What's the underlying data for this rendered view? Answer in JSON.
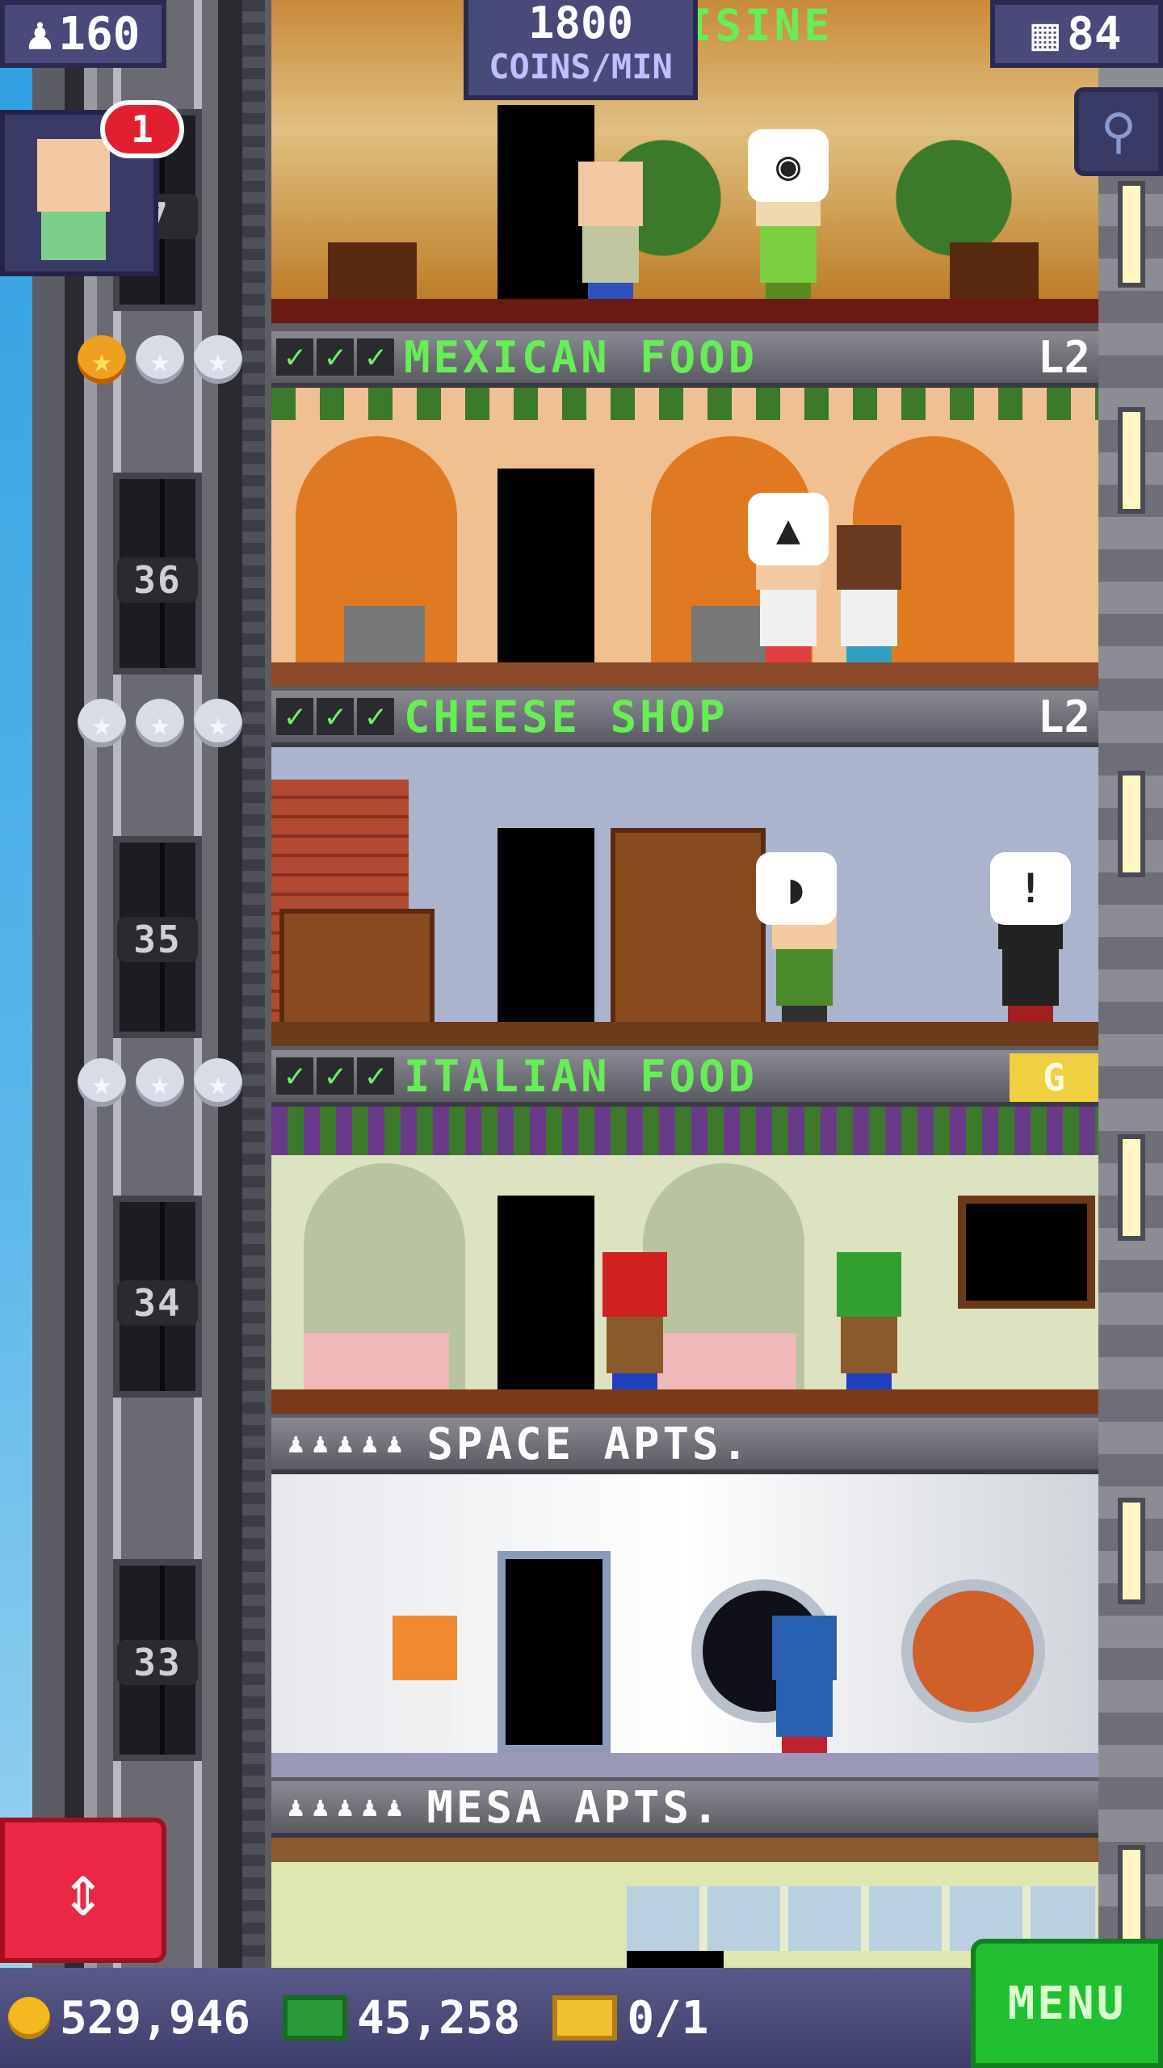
{
  "hud": {
    "population": "160",
    "coins_rate_value": "1800",
    "coins_rate_unit": "COINS/MIN",
    "floor_count": "84",
    "bitizen_notification": "1"
  },
  "elevator": {
    "floor_numbers": [
      "7",
      "36",
      "35",
      "34",
      "33"
    ]
  },
  "floors": [
    {
      "name": "MEXICAN FOOD",
      "level": "L2",
      "stars": "1 of 3",
      "stocked": 3
    },
    {
      "name": "CHEESE SHOP",
      "level": "L2",
      "stars": "0 of 3",
      "stocked": 3
    },
    {
      "name": "ITALIAN FOOD",
      "level": "",
      "badge": "G",
      "stars": "0 of 3",
      "stocked": 3
    },
    {
      "name": "SPACE APTS.",
      "residents": 5
    },
    {
      "name": "MESA APTS.",
      "residents": 5
    }
  ],
  "top_floor_partial_name": "CUISINE",
  "bubbles": {
    "cheese_alert": "!"
  },
  "bottom_bar": {
    "coins": "529,946",
    "bux": "45,258",
    "tickets": "0/1",
    "menu_label": "MENU"
  },
  "colors": {
    "floor_name_green": "#66ee55",
    "hud_panel": "#4a4a7a",
    "menu_green": "#20c030",
    "elevator_red": "#e82844",
    "notification_red": "#e02030"
  },
  "icons": [
    "population-icon",
    "floors-icon",
    "search-icon",
    "elevator-icon",
    "coin-icon",
    "bux-icon",
    "ticket-icon",
    "star-icon",
    "check-icon"
  ]
}
